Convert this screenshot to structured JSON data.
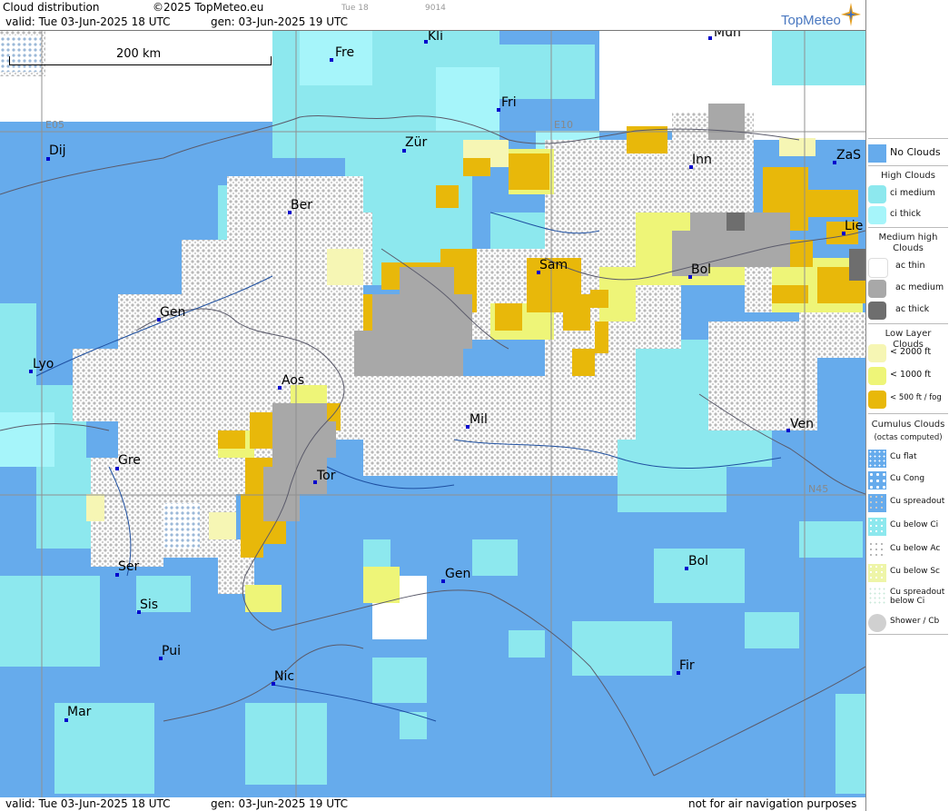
{
  "header": {
    "title": "Cloud distribution",
    "copyright": "©2025 TopMeteo.eu",
    "day_tag": "Tue 18",
    "code": "9014",
    "valid": "valid:  Tue  03-Jun-2025  18 UTC",
    "generated": "gen: 03-Jun-2025 19 UTC",
    "logo": "TopMeteo"
  },
  "footer": {
    "valid": "valid:  Tue  03-Jun-2025  18 UTC",
    "generated": "gen: 03-Jun-2025 19 UTC",
    "disclaimer": "not for air navigation purposes"
  },
  "map": {
    "scale_label": "200 km",
    "grid_labels": {
      "e05": "E05",
      "e10": "E10",
      "n45": "N45"
    },
    "cities": [
      "Kli",
      "Fre",
      "Mün",
      "Fri",
      "Dij",
      "Zür",
      "E10",
      "Inn",
      "ZaS",
      "Ber",
      "Lie",
      "Sam",
      "Bol",
      "Gen",
      "Lyo",
      "Aos",
      "Mil",
      "Ven",
      "Gre",
      "Tor",
      "Ser",
      "Gen",
      "Bol",
      "Sis",
      "Pui",
      "Nic",
      "Fir",
      "Mar"
    ]
  },
  "legend": {
    "no_clouds": "No Clouds",
    "high_title": "High Clouds",
    "ci_medium": "ci medium",
    "ci_thick": "ci thick",
    "medium_title": "Medium high Clouds",
    "ac_thin": "ac thin",
    "ac_medium": "ac medium",
    "ac_thick": "ac thick",
    "low_title": "Low Layer Clouds",
    "low_2000": "< 2000 ft",
    "low_1000": "< 1000 ft",
    "low_500": "< 500 ft / fog",
    "cu_title": "Cumulus Clouds",
    "cu_sub": "(octas computed)",
    "cu_flat": "Cu flat",
    "cu_cong": "Cu Cong",
    "cu_spread": "Cu spreadout",
    "cu_ci": "Cu below Ci",
    "cu_ac": "Cu below Ac",
    "cu_sc": "Cu below Sc",
    "cu_spread_ci": "Cu spreadout below Ci",
    "shower": "Shower / Cb"
  },
  "colors": {
    "no_clouds": "#66abec",
    "ci_medium": "#8de8ee",
    "ci_thick": "#a6f5fa",
    "ac_thin": "#ffffff",
    "ac_medium": "#a8a8a8",
    "ac_thick": "#6e6e6e",
    "low_2000": "#f6f6b4",
    "low_1000": "#eef578",
    "low_500": "#e8b80a"
  }
}
